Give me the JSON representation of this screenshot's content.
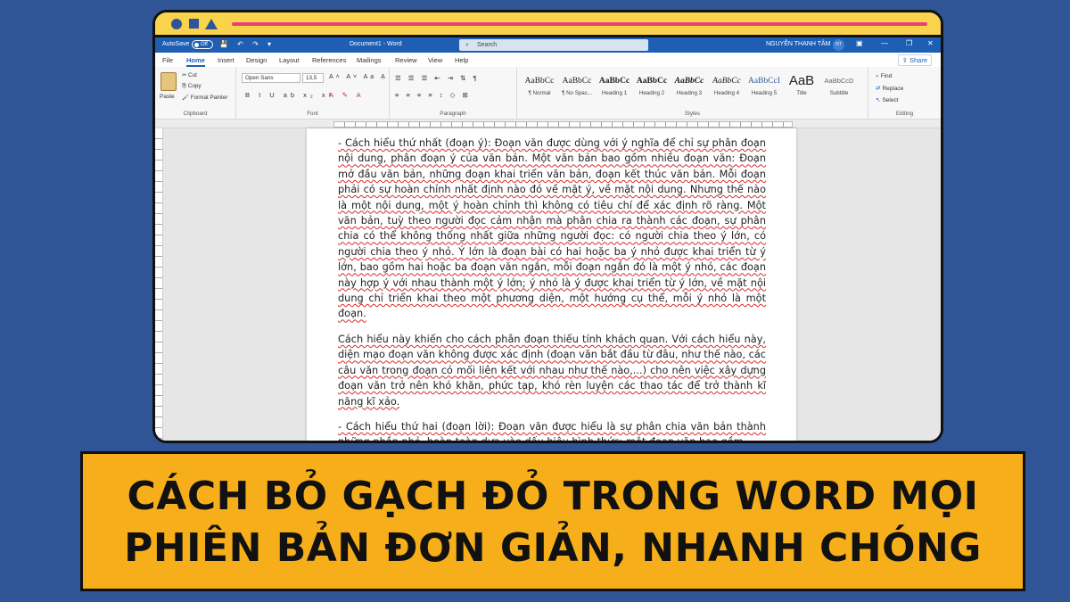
{
  "word": {
    "titlebar": {
      "autosave_label": "AutoSave",
      "toggle_state": "Off",
      "quick_access": "💾 ↶ ↷ ▾",
      "doc_title": "Document1 - Word",
      "search_placeholder": "Search",
      "user_name": "NGUYỄN THANH TÂM",
      "user_initials": "NT",
      "btn_ribbon_display": "▣",
      "btn_minimize": "—",
      "btn_restore": "❐",
      "btn_close": "✕"
    },
    "menu": {
      "tabs": [
        "File",
        "Home",
        "Insert",
        "Design",
        "Layout",
        "References",
        "Mailings",
        "Review",
        "View",
        "Help"
      ],
      "active_tab": "Home",
      "share_label": "Share"
    },
    "ribbon": {
      "clipboard": {
        "paste_label": "Paste",
        "cut_label": "Cut",
        "copy_label": "Copy",
        "format_painter_label": "Format Painter",
        "group_label": "Clipboard"
      },
      "font": {
        "font_name": "Open Sans",
        "font_size": "13,5",
        "row1_tools": "A˄ A˅ Aa Ạ",
        "row2_tools": "B I U ab x₂ x²",
        "row2_color_tools": "A ✎ A",
        "group_label": "Font"
      },
      "paragraph": {
        "row1_tools": "☰ ☰ ☰ ⇤ ⇥ ⇅ ¶",
        "row2_tools": "≡ ≡ ≡ ≡ ↕ ◇ ⊞",
        "group_label": "Paragraph"
      },
      "styles": {
        "items": [
          {
            "sample": "AaBbCc",
            "name": "¶ Normal"
          },
          {
            "sample": "AaBbCc",
            "name": "¶ No Spac..."
          },
          {
            "sample": "AaBbCc",
            "name": "Heading 1"
          },
          {
            "sample": "AaBbCc",
            "name": "Heading 2"
          },
          {
            "sample": "AaBbCc",
            "name": "Heading 3"
          },
          {
            "sample": "AaBbCc",
            "name": "Heading 4"
          },
          {
            "sample": "AaBbCcI",
            "name": "Heading 5"
          },
          {
            "sample": "AaB",
            "name": "Title"
          },
          {
            "sample": "AaBbCcD",
            "name": "Subtitle"
          }
        ],
        "group_label": "Styles"
      },
      "editing": {
        "find_label": "Find",
        "replace_label": "Replace",
        "select_label": "Select",
        "group_label": "Editing"
      }
    },
    "document": {
      "paragraphs": [
        "- Cách hiểu thứ nhất (đoạn ý): Đoạn văn được dùng với ý nghĩa để chỉ sự phân đoạn nội dung, phân đoạn ý của văn bản. Một văn bản bao gồm nhiều đoạn văn: Đoạn mở đầu văn bản, những đoạn khai triển văn bản, đoạn kết thúc văn bản. Mỗi đoạn phải có sự hoàn chỉnh nhất định nào đó về mặt ý, về mặt nội dung. Nhưng thế nào là một nội dung, một ý hoàn chỉnh thì không có tiêu chí để xác định rõ ràng. Một văn bản, tuỳ theo người đọc cảm nhận mà phân chia ra thành các đoạn, sự phân chia có thể không thống nhất giữa những người đọc: có người chia theo ý lớn, có người chia theo ý nhỏ. Ý lớn là đoạn bài có hai hoặc ba ý nhỏ được khai triển từ ý lớn, bao gồm hai hoặc ba đoạn văn ngắn, mỗi đoạn ngắn đó là một ý nhỏ, các đoạn này hợp ý với nhau thành một ý lớn; ý nhỏ là ý được khai triển từ ý lớn, về mặt nội dung chỉ triển khai theo một phương diện, một hướng cụ thể, mỗi ý nhỏ là một đoạn.",
        "Cách hiểu này khiến cho cách phân đoạn thiếu tính khách quan. Với cách hiểu này, diện mạo đoạn văn không được xác định (đoạn văn bắt đầu từ đâu, như thế nào, các câu văn trong đoạn có mối liên kết với nhau như thế nào,...) cho nên việc xây dựng đoạn văn trở nên khó khăn, phức tạp, khó rèn luyện các thao tác để trở thành kĩ năng kĩ xảo.",
        "- Cách hiểu thứ hai (đoạn lời): Đoạn văn được hiểu là sự phân chia văn bản thành những phần nhỏ, hoàn toàn dựa vào dấu hiệu hình thức: một đoạn văn bao gồm"
      ]
    }
  },
  "banner": {
    "line1": "CÁCH BỎ GẠCH ĐỎ TRONG WORD MỌI",
    "line2": "PHIÊN BẢN ĐƠN GIẢN, NHANH CHÓNG"
  },
  "colors": {
    "background": "#2f5597",
    "frame_header": "#f9d34b",
    "frame_address_bar": "#e8417a",
    "word_titlebar": "#1e5fb3",
    "banner": "#f7ae1b",
    "spellcheck_underline": "#d52c2c"
  }
}
